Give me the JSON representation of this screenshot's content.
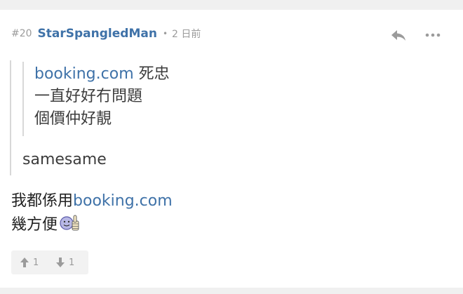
{
  "post": {
    "floor": "#20",
    "username": "StarSpangledMan",
    "separator": "•",
    "time": "2 日前"
  },
  "icons": {
    "reply": "reply-arrow-icon",
    "more": "more-dots-icon",
    "upvote": "arrow-up-icon",
    "downvote": "arrow-down-icon",
    "emoji": "thumbs-up-smiley-emoji"
  },
  "quote_inner": {
    "line1_link": "booking.com",
    "line1_text": " 死忠",
    "line2": "一直好好冇問題",
    "line3": "個價仲好靚"
  },
  "quote_outer": {
    "text": "samesame"
  },
  "body": {
    "line1_text": "我都係用",
    "line1_link": "booking.com",
    "line2_text": "幾方便"
  },
  "votes": {
    "up_count": "1",
    "down_count": "1"
  },
  "colors": {
    "link": "#3f72a8",
    "text": "#3c3c3c",
    "meta": "#9b9b9b",
    "background": "#f0f0f0"
  }
}
